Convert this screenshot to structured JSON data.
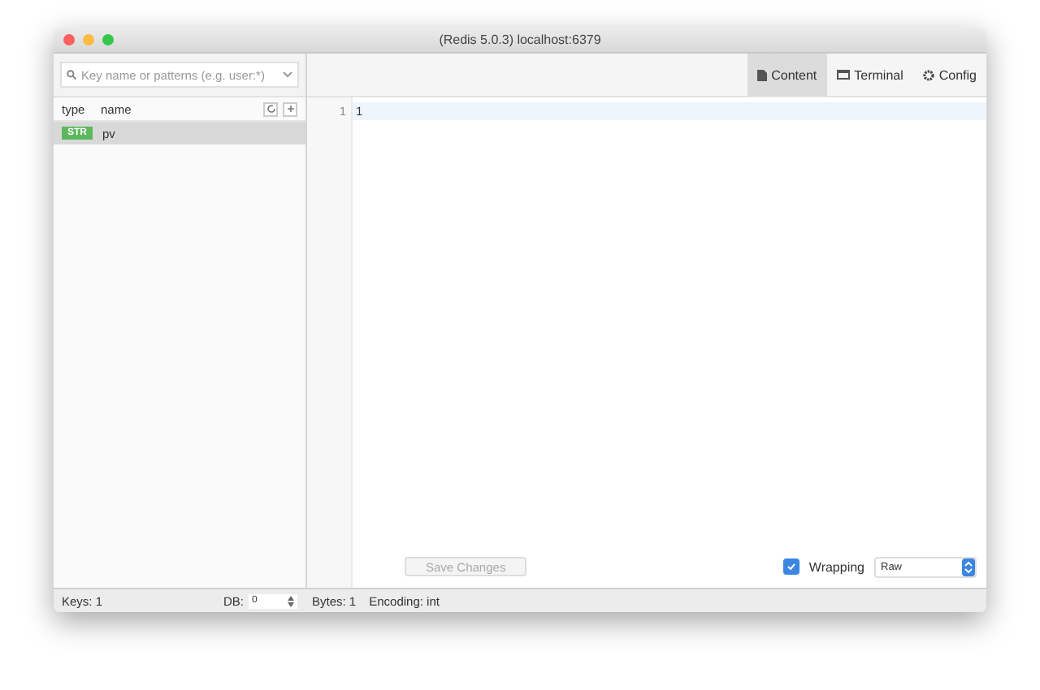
{
  "window": {
    "title": "(Redis 5.0.3) localhost:6379"
  },
  "search": {
    "placeholder": "Key name or patterns (e.g. user:*)"
  },
  "key_list": {
    "columns": [
      "type",
      "name"
    ],
    "rows": [
      {
        "type": "STR",
        "name": "pv",
        "selected": true
      }
    ]
  },
  "tabs": [
    {
      "label": "Content",
      "selected": true
    },
    {
      "label": "Terminal",
      "selected": false
    },
    {
      "label": "Config",
      "selected": false
    }
  ],
  "editor": {
    "lines": [
      {
        "number": "1",
        "text": "1"
      }
    ]
  },
  "footer": {
    "save_button": {
      "label": "Save Changes",
      "disabled": true
    },
    "wrapping": {
      "label": "Wrapping",
      "checked": true
    },
    "format": {
      "value": "Raw"
    }
  },
  "status_bar": {
    "keys": "Keys: 1",
    "db_label": "DB:",
    "db_value": "0",
    "bytes": "Bytes: 1",
    "encoding": "Encoding: int"
  }
}
